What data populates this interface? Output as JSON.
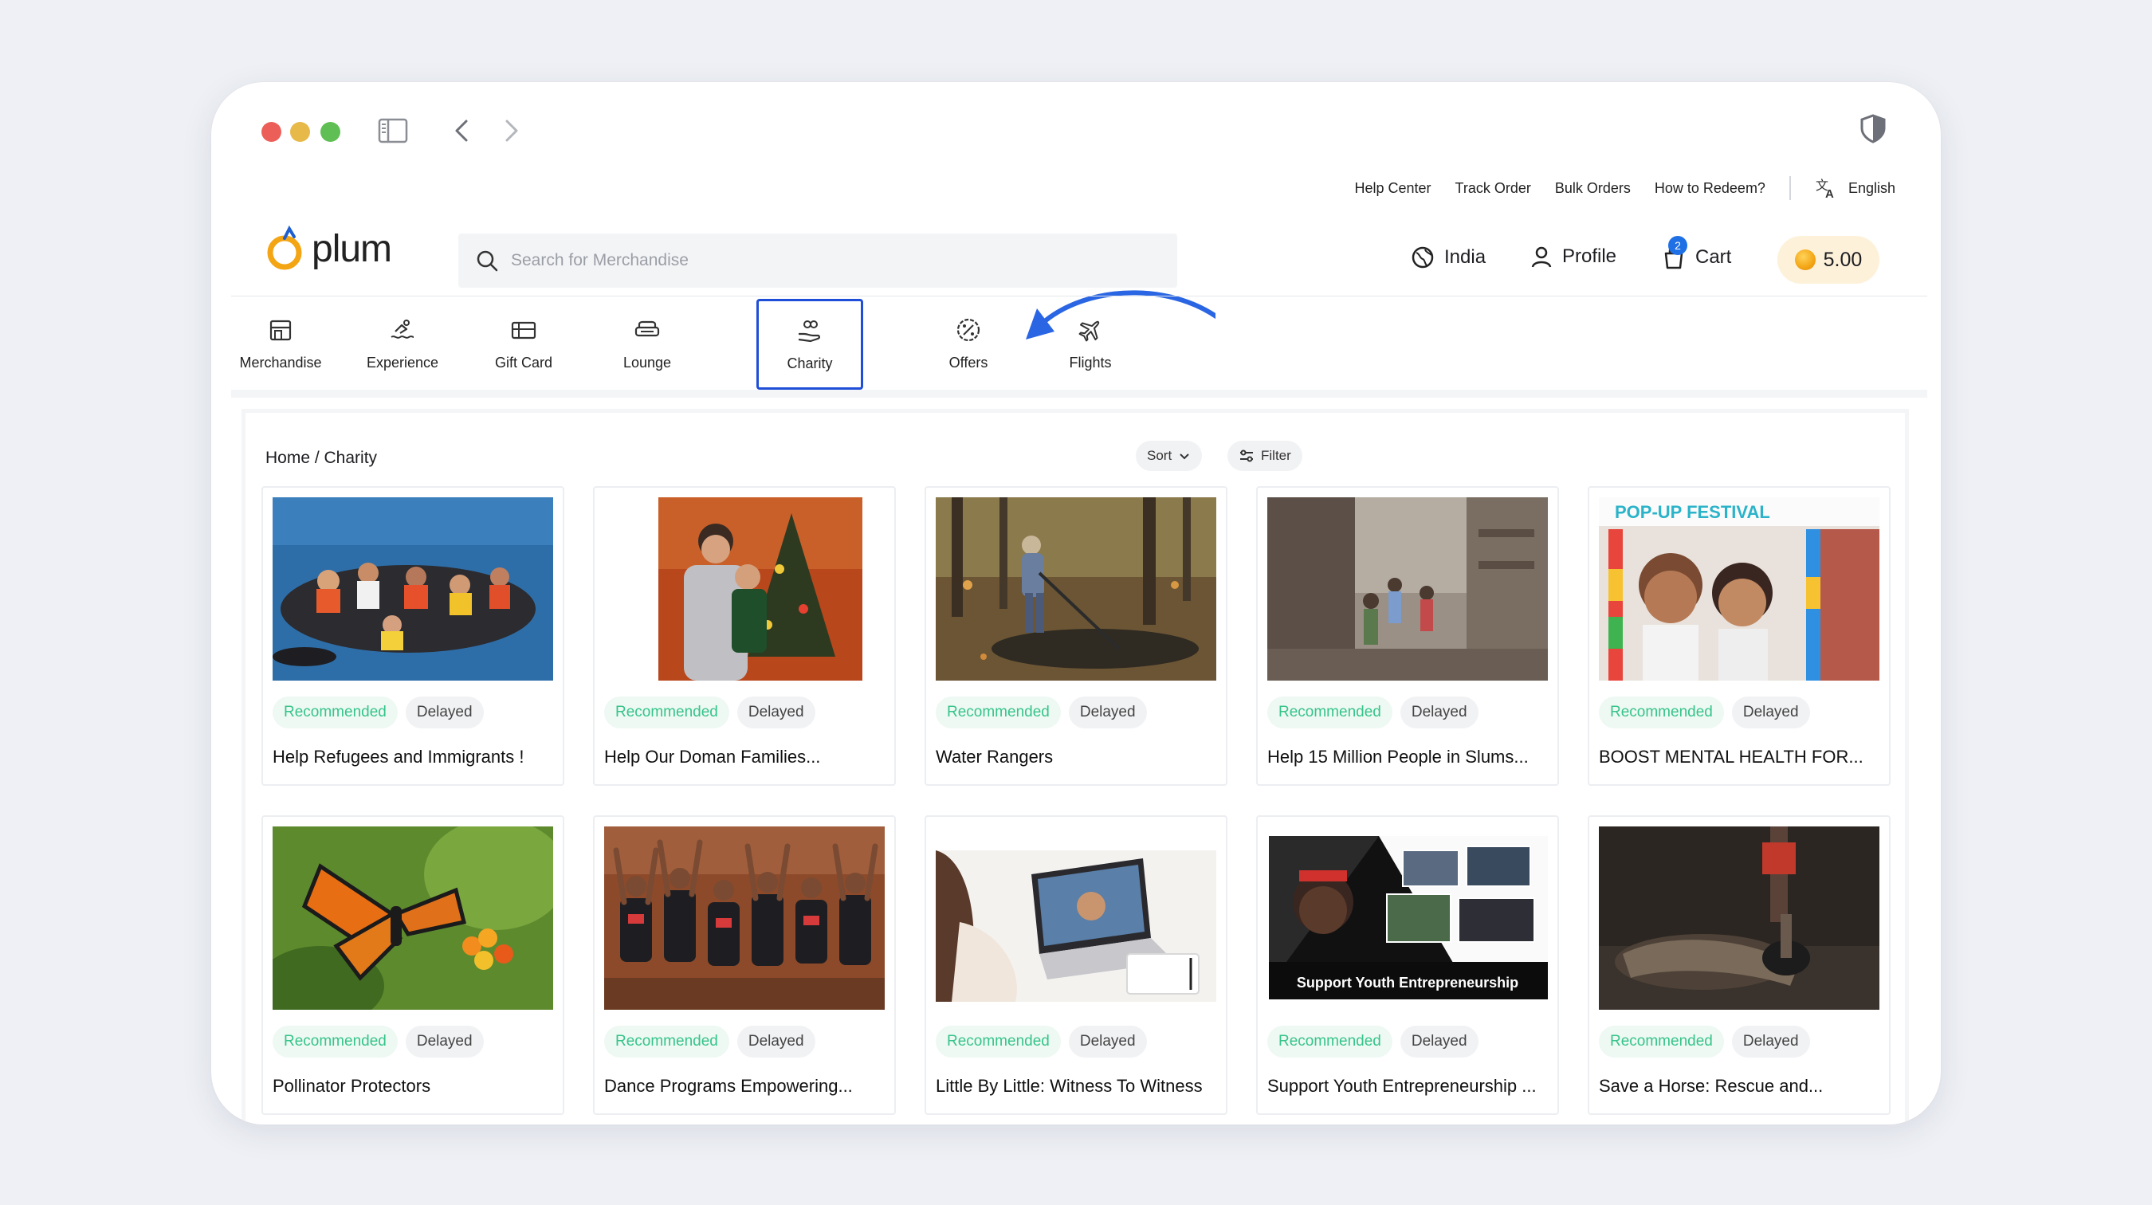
{
  "top_links": [
    "Help Center",
    "Track Order",
    "Bulk Orders",
    "How to Redeem?"
  ],
  "language": "English",
  "logo_text": "plum",
  "search": {
    "placeholder": "Search for Merchandise"
  },
  "header": {
    "country": "India",
    "profile": "Profile",
    "cart": "Cart",
    "cart_count": "2",
    "coins": "5.00"
  },
  "categories": [
    {
      "label": "Merchandise",
      "icon": "store-icon"
    },
    {
      "label": "Experience",
      "icon": "swimmer-icon"
    },
    {
      "label": "Gift Card",
      "icon": "gift-card-icon"
    },
    {
      "label": "Lounge",
      "icon": "sofa-icon"
    },
    {
      "label": "Charity",
      "icon": "charity-hand-icon",
      "active": true
    },
    {
      "label": "Offers",
      "icon": "discount-icon"
    },
    {
      "label": "Flights",
      "icon": "plane-icon"
    }
  ],
  "breadcrumb": "Home / Charity",
  "sort_label": "Sort",
  "filter_label": "Filter",
  "tag_recommended": "Recommended",
  "tag_delayed": "Delayed",
  "products": [
    {
      "title": "Help Refugees and Immigrants !",
      "image": "refugee-boat-photo"
    },
    {
      "title": "Help Our Doman Families...",
      "image": "family-christmas-photo"
    },
    {
      "title": "Water Rangers",
      "image": "forest-stream-photo"
    },
    {
      "title": "Help 15 Million People in Slums...",
      "image": "slum-street-photo"
    },
    {
      "title": "BOOST MENTAL HEALTH FOR...",
      "image": "children-festival-photo"
    },
    {
      "title": "Pollinator Protectors",
      "image": "butterfly-flower-photo"
    },
    {
      "title": "Dance Programs Empowering...",
      "image": "kids-dance-photo"
    },
    {
      "title": "Little By Little: Witness To Witness",
      "image": "laptop-call-photo"
    },
    {
      "title": "Support Youth Entrepreneurship ...",
      "image": "youth-entrepreneurship-collage"
    },
    {
      "title": "Save a Horse: Rescue and...",
      "image": "horse-hoof-photo"
    }
  ],
  "collage_caption": "Support Youth Entrepreneurship",
  "festival_banner": "POP-UP FESTIVAL",
  "colors": {
    "accent_blue": "#1f4ed8",
    "tag_green": "#36c48a",
    "coin_bg": "#fdf1d9",
    "logo_orange": "#f3a514"
  }
}
